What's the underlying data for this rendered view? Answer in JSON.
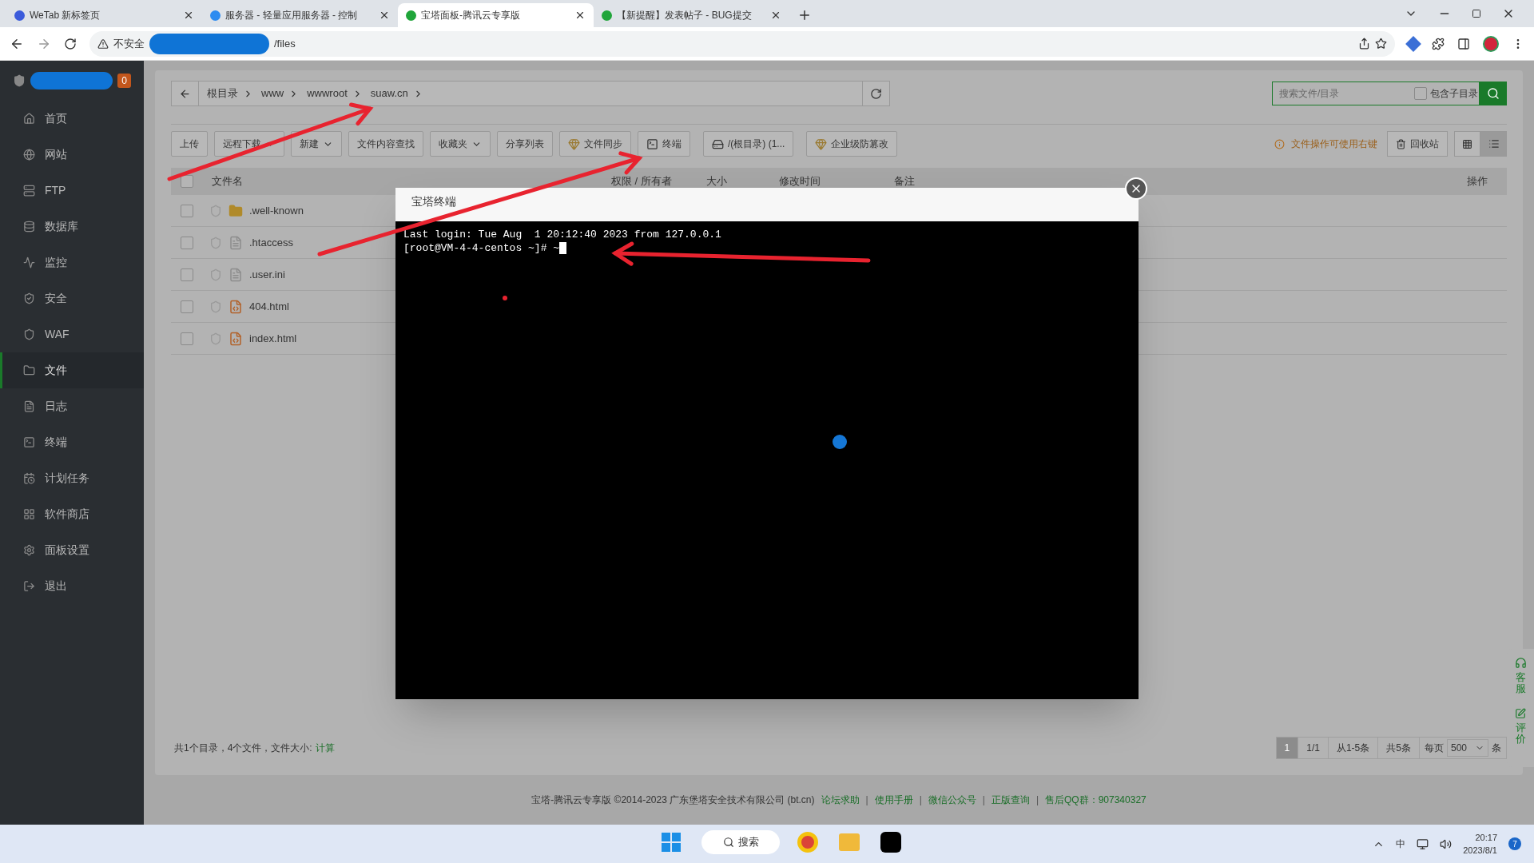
{
  "browser": {
    "tabs": [
      {
        "title": "WeTab 新标签页",
        "selected": false
      },
      {
        "title": "服务器 - 轻量应用服务器 - 控制",
        "selected": false
      },
      {
        "title": "宝塔面板-腾讯云专享版",
        "selected": true
      },
      {
        "title": "【新提醒】发表帖子 - BUG提交",
        "selected": false
      }
    ],
    "security_label": "不安全",
    "url_tail": "/files"
  },
  "sidebar": {
    "badge": "0",
    "items": [
      {
        "label": "首页",
        "selected": false
      },
      {
        "label": "网站",
        "selected": false
      },
      {
        "label": "FTP",
        "selected": false
      },
      {
        "label": "数据库",
        "selected": false
      },
      {
        "label": "监控",
        "selected": false
      },
      {
        "label": "安全",
        "selected": false
      },
      {
        "label": "WAF",
        "selected": false
      },
      {
        "label": "文件",
        "selected": true
      },
      {
        "label": "日志",
        "selected": false
      },
      {
        "label": "终端",
        "selected": false
      },
      {
        "label": "计划任务",
        "selected": false
      },
      {
        "label": "软件商店",
        "selected": false
      },
      {
        "label": "面板设置",
        "selected": false
      },
      {
        "label": "退出",
        "selected": false
      }
    ]
  },
  "breadcrumb": [
    "根目录",
    "www",
    "wwwroot",
    "suaw.cn"
  ],
  "search": {
    "placeholder": "搜索文件/目录",
    "include_subdirs": {
      "label": "包含子目录",
      "checked": false
    }
  },
  "toolbar": [
    {
      "label": "上传",
      "kind": "plain"
    },
    {
      "label": "远程下载",
      "kind": "dropdown"
    },
    {
      "label": "新建",
      "kind": "dropdown"
    },
    {
      "label": "文件内容查找",
      "kind": "plain"
    },
    {
      "label": "收藏夹",
      "kind": "dropdown"
    },
    {
      "label": "分享列表",
      "kind": "plain"
    },
    {
      "label": "文件同步",
      "kind": "premium"
    },
    {
      "label": "终端",
      "kind": "terminal"
    },
    {
      "label": "/(根目录) (1...",
      "kind": "disk"
    },
    {
      "label": "企业级防篡改",
      "kind": "premium"
    }
  ],
  "hint": "文件操作可使用右键",
  "recycle": "回收站",
  "views": [
    {
      "kind": "grid",
      "selected": false
    },
    {
      "kind": "list",
      "selected": true
    }
  ],
  "table": {
    "columns": [
      "文件名",
      "权限 / 所有者",
      "大小",
      "修改时间",
      "备注",
      "操作"
    ],
    "header_checked": false,
    "rows": [
      {
        "name": ".well-known",
        "kind": "folder",
        "checked": false
      },
      {
        "name": ".htaccess",
        "kind": "file",
        "checked": false
      },
      {
        "name": ".user.ini",
        "kind": "file",
        "checked": false
      },
      {
        "name": "404.html",
        "kind": "html",
        "checked": false
      },
      {
        "name": "index.html",
        "kind": "html",
        "checked": false
      }
    ]
  },
  "summary": {
    "text": "共1个目录，4个文件，文件大小:",
    "link": "计算"
  },
  "pagination": {
    "pages": [
      {
        "label": "1",
        "selected": true
      }
    ],
    "items": [
      "1/1",
      "从1-5条",
      "共5条"
    ],
    "per_page_label": "每页",
    "per_page": "500",
    "unit": "条"
  },
  "float_panel": [
    "客服",
    "评价"
  ],
  "modal": {
    "title": "宝塔终端",
    "lines": [
      "Last login: Tue Aug  1 20:12:40 2023 from 127.0.0.1",
      "[root@VM-4-4-centos ~]# ~"
    ]
  },
  "footer": {
    "copyright": "宝塔-腾讯云专享版 ©2014-2023 广东堡塔安全技术有限公司 (bt.cn)",
    "links": [
      "论坛求助",
      "使用手册",
      "微信公众号",
      "正版查询",
      "售后QQ群：907340327"
    ],
    "separator": "|"
  },
  "taskbar": {
    "search": "搜索",
    "ime": "中",
    "time": "20:17",
    "date": "2023/8/1",
    "notifications": "7"
  }
}
